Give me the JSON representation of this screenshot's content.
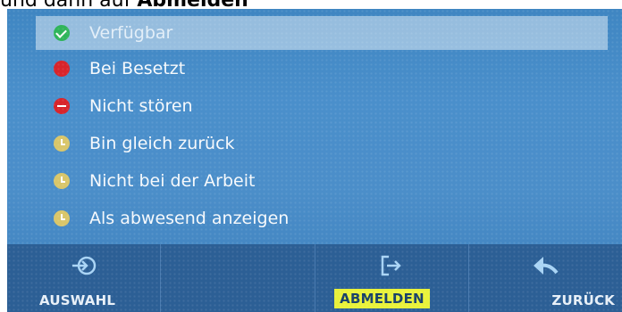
{
  "caption": {
    "prefix": "und dann auf ",
    "bold": "Abmelden"
  },
  "menu": {
    "items": [
      {
        "label": "Verfügbar",
        "icon": "available-check-icon",
        "color": "#2fb45a",
        "selected": true
      },
      {
        "label": "Bei Besetzt",
        "icon": "busy-dot-icon",
        "color": "#d8242b"
      },
      {
        "label": "Nicht stören",
        "icon": "do-not-disturb-icon",
        "color": "#d8242b"
      },
      {
        "label": "Bin gleich zurück",
        "icon": "clock-icon",
        "color": "#d9c66a"
      },
      {
        "label": "Nicht bei der Arbeit",
        "icon": "clock-icon",
        "color": "#d9c66a"
      },
      {
        "label": "Als abwesend anzeigen",
        "icon": "clock-icon",
        "color": "#d9c66a"
      }
    ]
  },
  "softkeys": {
    "select": {
      "label": "AUSWAHL",
      "icon": "select-arrow-icon"
    },
    "empty": {
      "label": ""
    },
    "logout": {
      "label": "ABMELDEN",
      "icon": "logout-icon",
      "highlight": "#e9f23a"
    },
    "back": {
      "label": "ZURÜCK",
      "icon": "back-arrow-icon"
    }
  }
}
